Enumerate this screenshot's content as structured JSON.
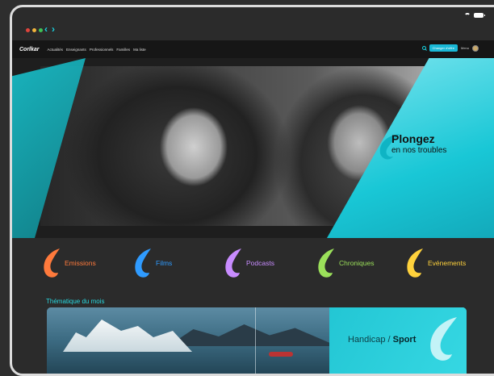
{
  "app": {
    "logo": "Corlkar",
    "colors": {
      "accent": "#19d3e0",
      "cta": "#19b8d6"
    }
  },
  "window": {
    "controls": [
      "#e0443c",
      "#f1b43c",
      "#3fc355"
    ]
  },
  "nav": {
    "back": "‹",
    "forward": "›",
    "links": [
      "Actualités",
      "Enseignants",
      "Professionnels",
      "Familles",
      "Ma liste"
    ],
    "cta_label": "Changer d'offre",
    "menu_label": "Menu"
  },
  "hero": {
    "title": "Plongez",
    "subtitle": "en nos troubles"
  },
  "categories": [
    {
      "label": "Emissions",
      "color": "#ff7a3c"
    },
    {
      "label": "Films",
      "color": "#2f9bff"
    },
    {
      "label": "Podcasts",
      "color": "#c88cff"
    },
    {
      "label": "Chroniques",
      "color": "#9be05a"
    },
    {
      "label": "Evénements",
      "color": "#ffd23c"
    }
  ],
  "section": {
    "title": "Thématique du mois"
  },
  "banner": {
    "text_a": "Handicap / ",
    "text_b": "Sport"
  }
}
